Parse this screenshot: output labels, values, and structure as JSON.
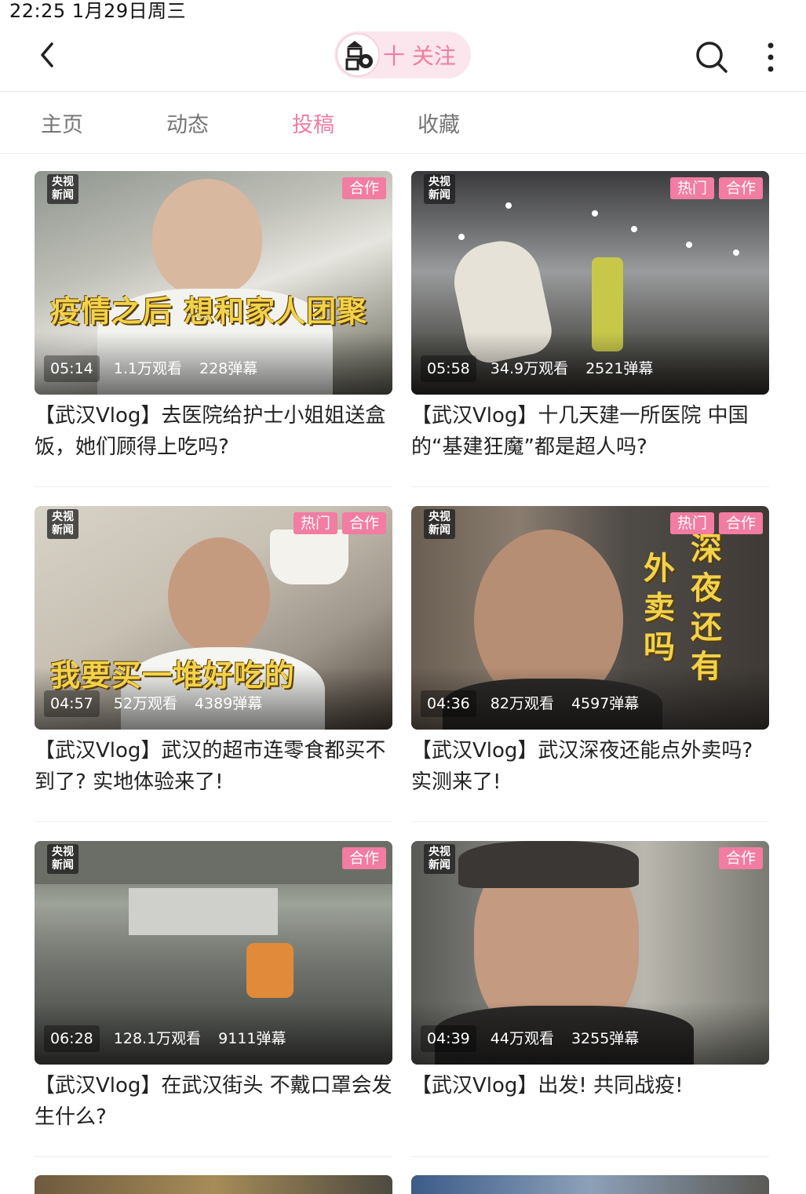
{
  "status_bar": {
    "text": "22:25   1月29日周三"
  },
  "header": {
    "back_icon": "chevron-left-icon",
    "follow_label": "十 关注",
    "search_icon": "search-icon",
    "more_icon": "more-vertical-icon"
  },
  "tabs": [
    {
      "label": "主页",
      "active": false
    },
    {
      "label": "动态",
      "active": false
    },
    {
      "label": "投稿",
      "active": true
    },
    {
      "label": "收藏",
      "active": false
    }
  ],
  "colors": {
    "accent": "#f07ea1",
    "tag_bg": "#f27ca2",
    "caption": "#f2d24a"
  },
  "videos": [
    {
      "logo": "央视新闻",
      "tags": [
        "合作"
      ],
      "caption": "疫情之后 想和家人团聚",
      "duration": "05:14",
      "views": "1.1万观看",
      "danmaku": "228弹幕",
      "title": "【武汉Vlog】去医院给护士小姐姐送盒饭，她们顾得上吃吗?"
    },
    {
      "logo": "央视新闻",
      "tags": [
        "热门",
        "合作"
      ],
      "caption": "",
      "duration": "05:58",
      "views": "34.9万观看",
      "danmaku": "2521弹幕",
      "title": "【武汉Vlog】十几天建一所医院  中国的“基建狂魔”都是超人吗?"
    },
    {
      "logo": "央视新闻",
      "tags": [
        "热门",
        "合作"
      ],
      "caption": "我要买一堆好吃的",
      "duration": "04:57",
      "views": "52万观看",
      "danmaku": "4389弹幕",
      "title": "【武汉Vlog】武汉的超市连零食都买不到了? 实地体验来了!"
    },
    {
      "logo": "央视新闻",
      "tags": [
        "热门",
        "合作"
      ],
      "caption_col1": "外卖吗",
      "caption_col2": "深夜还有",
      "duration": "04:36",
      "views": "82万观看",
      "danmaku": "4597弹幕",
      "title": "【武汉Vlog】武汉深夜还能点外卖吗? 实测来了!"
    },
    {
      "logo": "央视新闻",
      "tags": [
        "合作"
      ],
      "caption": "",
      "duration": "06:28",
      "views": "128.1万观看",
      "danmaku": "9111弹幕",
      "title": "【武汉Vlog】在武汉街头  不戴口罩会发生什么?"
    },
    {
      "logo": "央视新闻",
      "tags": [
        "合作"
      ],
      "caption": "",
      "duration": "04:39",
      "views": "44万观看",
      "danmaku": "3255弹幕",
      "title": "【武汉Vlog】出发! 共同战疫!"
    }
  ]
}
